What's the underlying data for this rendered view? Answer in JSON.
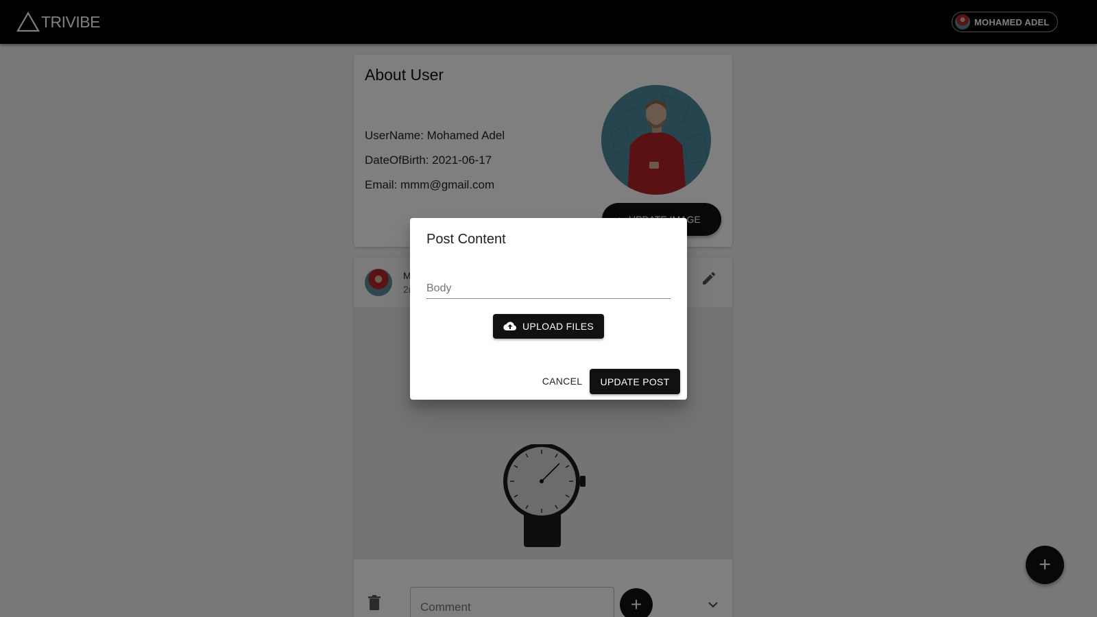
{
  "app": {
    "logo_text": "TRIVIBE"
  },
  "header": {
    "user_name": "MOHAMED ADEL"
  },
  "about": {
    "title": "About User",
    "username": "UserName: Mohamed Adel",
    "dob": "DateOfBirth: 2021-06-17",
    "email": "Email: mmm@gmail.com",
    "update_image_label": "UPDATE IMAGE"
  },
  "post": {
    "author_initial": "M",
    "date_partial": "2(",
    "comment_placeholder": "Comment"
  },
  "dialog": {
    "title": "Post Content",
    "body_placeholder": "Body",
    "upload_label": "UPLOAD FILES",
    "cancel_label": "CANCEL",
    "submit_label": "UPDATE POST"
  },
  "icons": {
    "logo": "triangle-logo-icon",
    "edit": "pencil-icon",
    "delete": "trash-icon",
    "upload": "cloud-upload-icon",
    "expand": "chevron-down-icon",
    "add": "plus-icon"
  },
  "colors": {
    "appbar": "#000000",
    "accent": "#111111",
    "backdrop": "rgba(0,0,0,0.5)"
  }
}
